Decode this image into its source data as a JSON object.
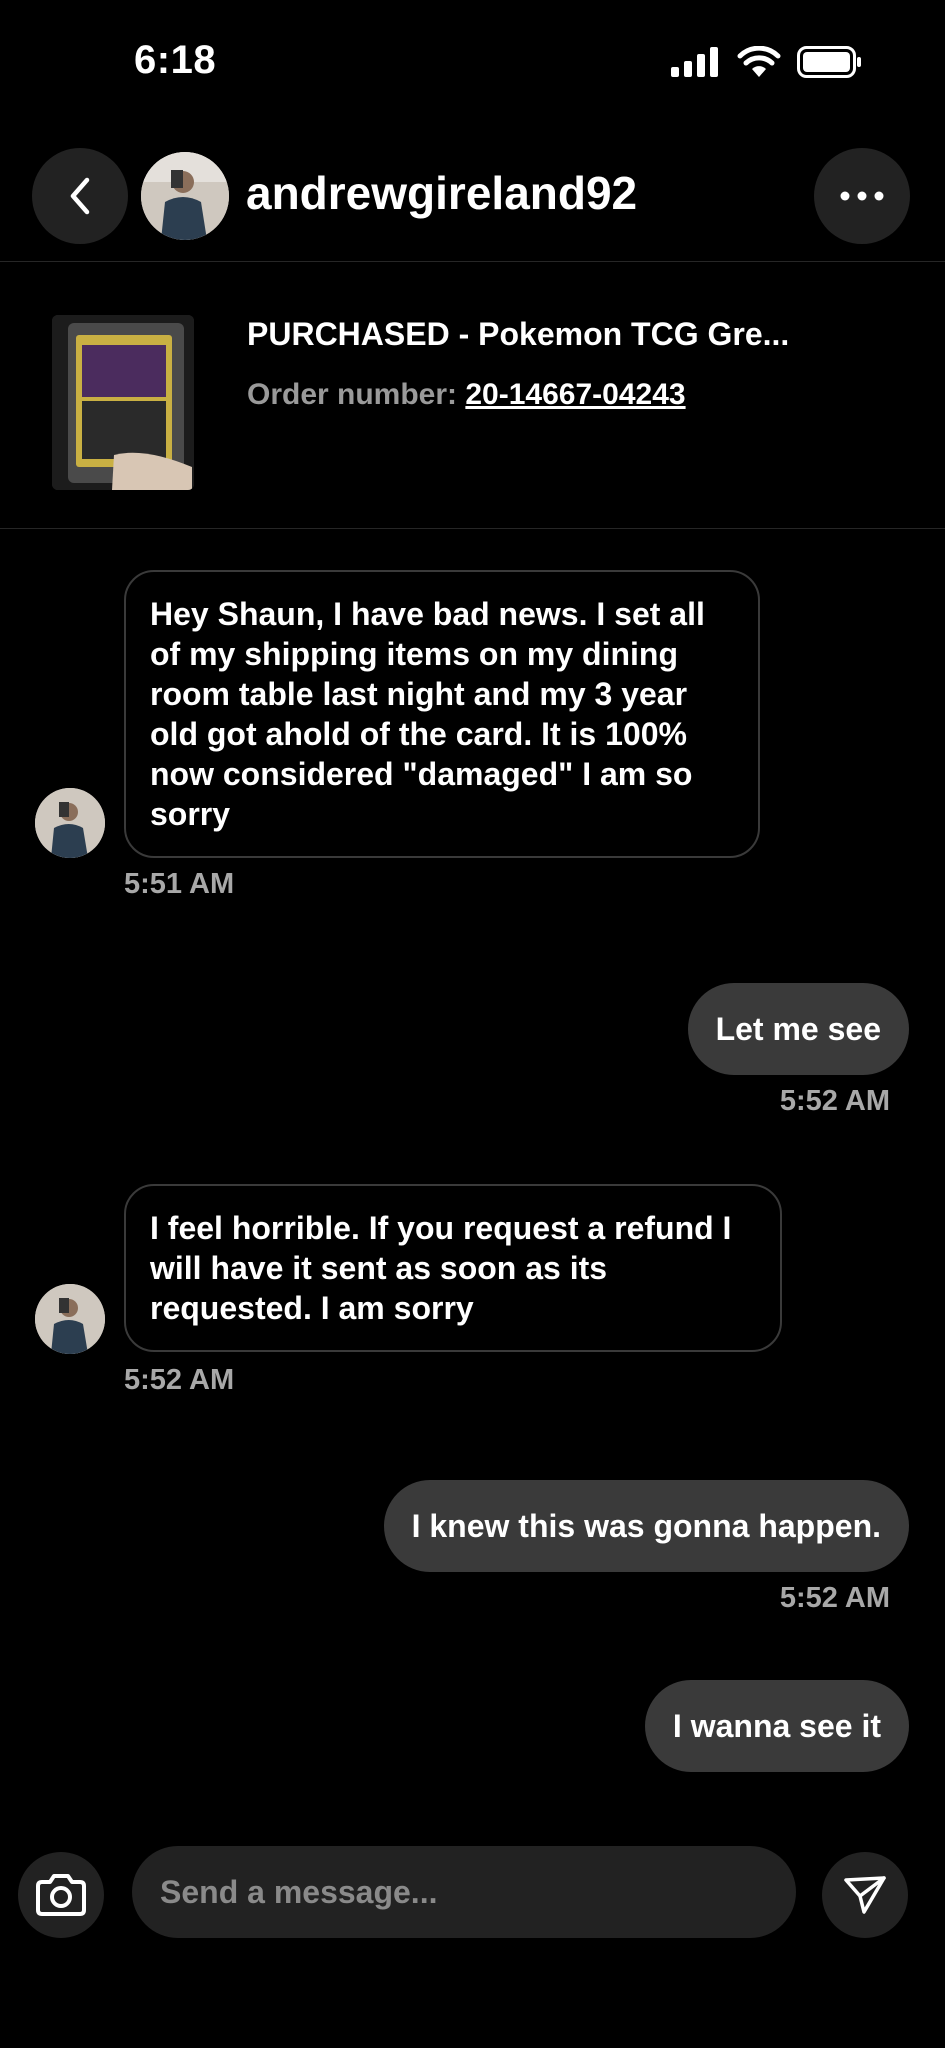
{
  "status_bar": {
    "time": "6:18",
    "icons": [
      "signal-icon",
      "wifi-icon",
      "battery-icon"
    ]
  },
  "header": {
    "username": "andrewgireland92",
    "back_icon": "chevron-left-icon",
    "more_icon": "more-dots-icon"
  },
  "item": {
    "title": "PURCHASED - Pokemon TCG Gre...",
    "order_label": "Order number:",
    "order_number": "20-14667-04243"
  },
  "messages": [
    {
      "direction": "incoming",
      "text": "Hey Shaun, I have bad news. I set all of my shipping items on my dining room table last night and my 3 year old got ahold of the card. It is 100% now considered \"damaged\" I am so sorry",
      "time": "5:51 AM"
    },
    {
      "direction": "outgoing",
      "text": "Let me see",
      "time": "5:52 AM"
    },
    {
      "direction": "incoming",
      "text": "I feel horrible. If you request a refund I will have it sent as soon as its requested. I am sorry",
      "time": "5:52 AM"
    },
    {
      "direction": "outgoing",
      "text": "I knew this was gonna happen.",
      "time": "5:52 AM"
    },
    {
      "direction": "outgoing",
      "text": "I wanna see it",
      "time": ""
    }
  ],
  "composer": {
    "placeholder": "Send a message...",
    "camera_icon": "camera-icon",
    "send_icon": "send-icon"
  },
  "colors": {
    "background": "#000000",
    "bubble_out": "#3a3a3a",
    "bubble_in_border": "#3a3a3a",
    "timestamp": "#a8a8a8"
  }
}
